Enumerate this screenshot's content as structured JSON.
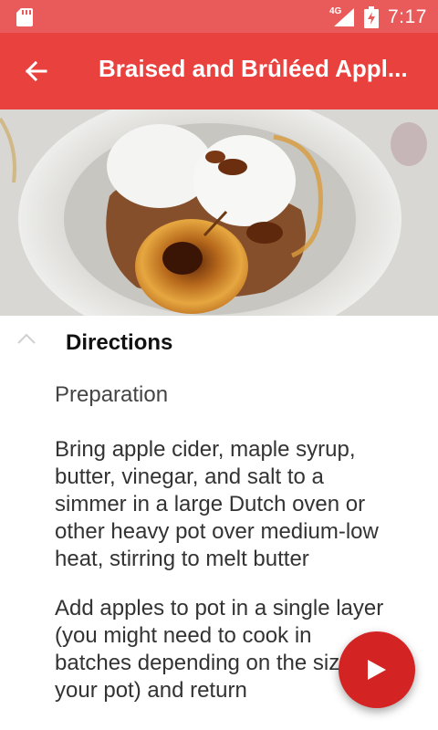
{
  "status_bar": {
    "network": "4G",
    "time": "7:17",
    "icons": [
      "sd-card-icon",
      "signal-icon",
      "battery-icon"
    ]
  },
  "app_bar": {
    "title": "Braised and Brûléed Appl...",
    "back_icon": "arrow-back-icon"
  },
  "section": {
    "header": "Directions",
    "collapse_icon": "chevron-up-icon"
  },
  "directions": {
    "subtitle": "Preparation",
    "steps": [
      "Bring apple cider, maple syrup, butter, vinegar, and salt to a simmer in a large Dutch oven or other heavy pot over medium-low heat, stirring to melt butter",
      "Add apples to pot in a single layer (you might need to cook in batches depending on the size of your pot) and return"
    ]
  },
  "fab": {
    "icon": "play-icon"
  },
  "colors": {
    "status_bar": "#e95a5a",
    "app_bar": "#e8413e",
    "fab": "#d32323"
  }
}
